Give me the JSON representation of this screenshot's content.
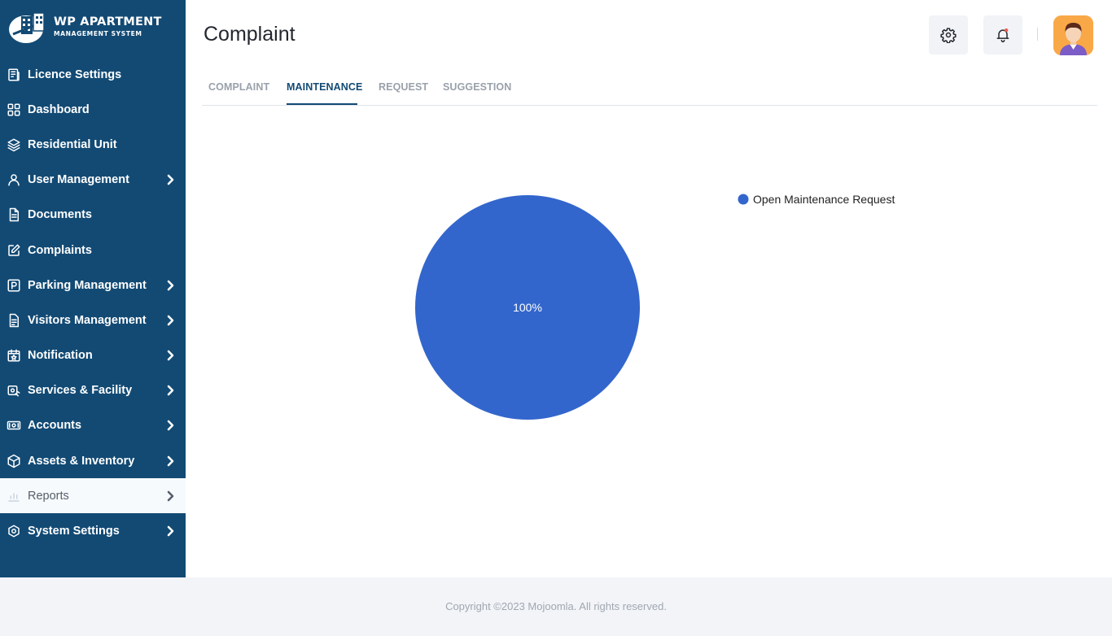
{
  "app": {
    "logo_title": "WP APARTMENT",
    "logo_subtitle": "MANAGEMENT SYSTEM"
  },
  "sidebar": {
    "items": [
      {
        "label": "Licence Settings",
        "icon": "licence-icon",
        "has_arrow": false,
        "active": false
      },
      {
        "label": "Dashboard",
        "icon": "dashboard-icon",
        "has_arrow": false,
        "active": false
      },
      {
        "label": "Residential Unit",
        "icon": "layers-icon",
        "has_arrow": false,
        "active": false
      },
      {
        "label": "User Management",
        "icon": "user-icon",
        "has_arrow": true,
        "active": false
      },
      {
        "label": "Documents",
        "icon": "document-icon",
        "has_arrow": false,
        "active": false
      },
      {
        "label": "Complaints",
        "icon": "edit-icon",
        "has_arrow": false,
        "active": false
      },
      {
        "label": "Parking Management",
        "icon": "parking-icon",
        "has_arrow": true,
        "active": false
      },
      {
        "label": "Visitors Management",
        "icon": "visitors-icon",
        "has_arrow": true,
        "active": false
      },
      {
        "label": "Notification",
        "icon": "calendar-star-icon",
        "has_arrow": true,
        "active": false
      },
      {
        "label": "Services & Facility",
        "icon": "services-icon",
        "has_arrow": true,
        "active": false
      },
      {
        "label": "Accounts",
        "icon": "money-icon",
        "has_arrow": true,
        "active": false
      },
      {
        "label": "Assets & Inventory",
        "icon": "box-icon",
        "has_arrow": true,
        "active": false
      },
      {
        "label": "Reports",
        "icon": "reports-icon",
        "has_arrow": true,
        "active": true
      },
      {
        "label": "System Settings",
        "icon": "settings-eye-icon",
        "has_arrow": true,
        "active": false
      }
    ]
  },
  "header": {
    "title": "Complaint",
    "settings_icon": "gear-icon",
    "notification_icon": "bell-icon",
    "avatar_icon": "user-avatar"
  },
  "tabs": [
    {
      "label": "COMPLAINT",
      "active": false
    },
    {
      "label": "MAINTENANCE",
      "active": true
    },
    {
      "label": "REQUEST",
      "active": false
    },
    {
      "label": "SUGGESTION",
      "active": false
    }
  ],
  "chart_data": {
    "type": "pie",
    "series": [
      {
        "name": "Open Maintenance Request",
        "value": 100,
        "label": "100%",
        "color": "#3366cc"
      }
    ],
    "legend_position": "right"
  },
  "footer": {
    "text": "Copyright ©2023 Mojoomla. All rights reserved."
  },
  "colors": {
    "sidebar_bg": "#124a74",
    "accent": "#124a74",
    "pie_blue": "#3366cc",
    "notification_dot": "#f05a4f"
  }
}
